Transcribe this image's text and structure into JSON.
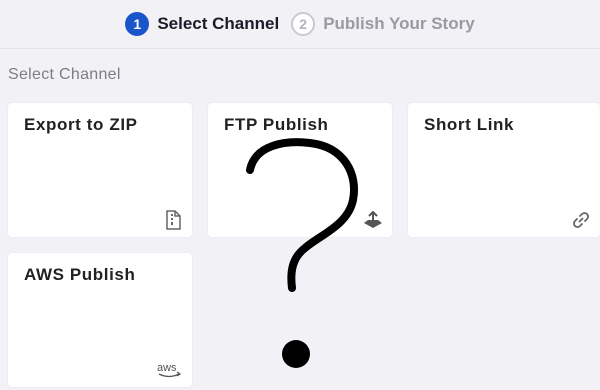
{
  "steps": [
    {
      "number": "1",
      "label": "Select Channel",
      "state": "active"
    },
    {
      "number": "2",
      "label": "Publish Your Story",
      "state": "inactive"
    }
  ],
  "section_title": "Select Channel",
  "channels": [
    {
      "label": "Export to ZIP",
      "icon": "zip-file-icon"
    },
    {
      "label": "FTP Publish",
      "icon": "upload-tray-icon"
    },
    {
      "label": "Short Link",
      "icon": "link-icon"
    },
    {
      "label": "AWS Publish",
      "icon": "aws-logo-icon",
      "icon_text": "aws"
    }
  ],
  "colors": {
    "accent": "#1a56c9",
    "background": "#f1f1f6"
  }
}
